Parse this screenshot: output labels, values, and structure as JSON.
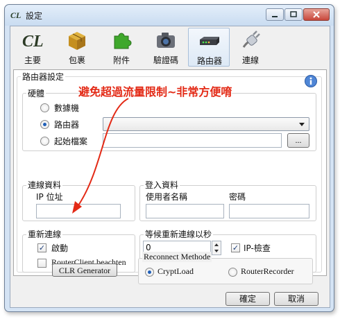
{
  "window": {
    "title": "設定"
  },
  "toolbar": {
    "items": [
      {
        "label": "主要",
        "icon": "cl-logo-icon"
      },
      {
        "label": "包裹",
        "icon": "package-icon"
      },
      {
        "label": "附件",
        "icon": "puzzle-piece-icon"
      },
      {
        "label": "驗證碼",
        "icon": "camera-icon"
      },
      {
        "label": "路由器",
        "icon": "router-icon",
        "selected": true
      },
      {
        "label": "連線",
        "icon": "plug-icon"
      }
    ]
  },
  "router_settings": {
    "title": "路由器設定",
    "hardware": {
      "title": "硬體",
      "options": [
        {
          "label": "數據機",
          "selected": false
        },
        {
          "label": "路由器",
          "selected": true
        },
        {
          "label": "起始檔案",
          "selected": false
        }
      ],
      "browse_label": "..."
    },
    "connection_info": {
      "title": "連線資料",
      "ip_label": "IP 位址",
      "ip_value": ""
    },
    "login_info": {
      "title": "登入資料",
      "username_label": "使用者名稱",
      "password_label": "密碼",
      "username_value": "",
      "password_value": ""
    },
    "reconnect": {
      "title": "重新連線",
      "enable_label": "啟動",
      "enable_checked": true,
      "routerclient_label": "RouterClient beachten",
      "routerclient_checked": false
    },
    "wait": {
      "title": "等候重新連線以秒",
      "seconds_value": "0",
      "ip_check_label": "IP-檢查",
      "ip_check_checked": true
    },
    "clr_button": "CLR Generator",
    "reconnect_method": {
      "title": "Reconnect Methode",
      "options": [
        {
          "label": "CryptLoad",
          "selected": true
        },
        {
          "label": "RouterRecorder",
          "selected": false
        }
      ]
    }
  },
  "annotation": {
    "text": "避免超過流量限制~非常方便唷",
    "color": "#e32a16"
  },
  "footer": {
    "ok_label": "確定",
    "cancel_label": "取消"
  }
}
